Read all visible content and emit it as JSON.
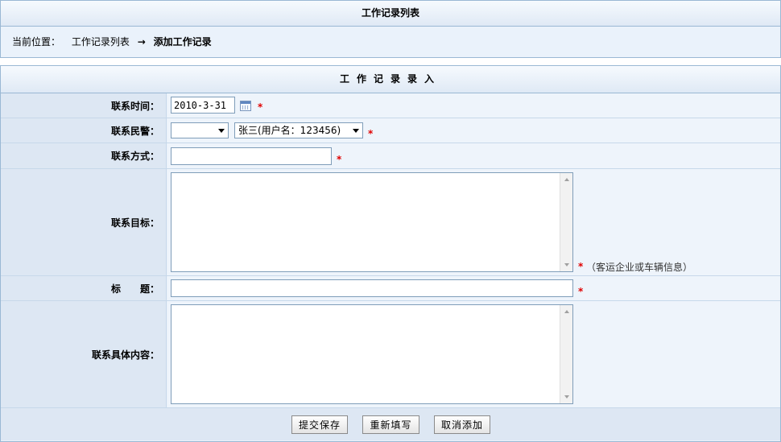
{
  "list_panel": {
    "title": "工作记录列表",
    "location_label": "当前位置：",
    "breadcrumb_link": "工作记录列表",
    "arrow": "→",
    "breadcrumb_current": "添加工作记录"
  },
  "form": {
    "title": "工作记录录入",
    "required_mark": "*",
    "contact_time": {
      "label": "联系时间：",
      "value": "2010-3-31"
    },
    "contact_police": {
      "label": "联系民警：",
      "select1_value": "",
      "select2_value": "张三(用户名：123456)"
    },
    "contact_method": {
      "label": "联系方式：",
      "value": ""
    },
    "contact_target": {
      "label": "联系目标：",
      "value": "",
      "hint": "（客运企业或车辆信息）"
    },
    "subject": {
      "label": "标　　题：",
      "value": ""
    },
    "details": {
      "label": "联系具体内容：",
      "value": ""
    },
    "buttons": {
      "submit": "提交保存",
      "reset": "重新填写",
      "cancel": "取消添加"
    }
  }
}
